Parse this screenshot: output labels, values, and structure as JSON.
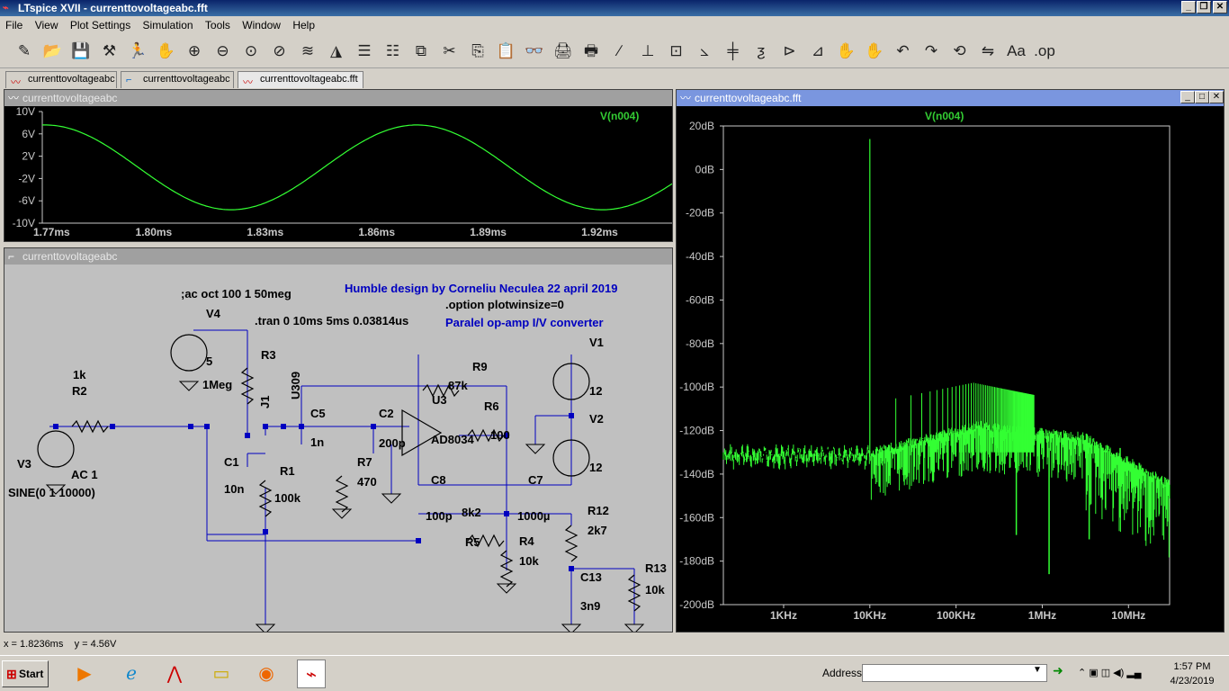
{
  "window": {
    "title": "LTspice XVII - currenttovoltageabc.fft"
  },
  "menu": [
    "File",
    "View",
    "Plot Settings",
    "Simulation",
    "Tools",
    "Window",
    "Help"
  ],
  "toolbar_icons": [
    "new-schematic-icon",
    "open-icon",
    "save-icon",
    "control-panel-icon",
    "run-icon",
    "halt-icon",
    "zoom-in-icon",
    "zoom-out-icon",
    "zoom-full-icon",
    "zoom-cancel-icon",
    "autorange-icon",
    "pick-visible-icon",
    "tile-icon",
    "cascade-icon",
    "close-icon",
    "cut-icon",
    "copy-icon",
    "paste-icon",
    "find-icon",
    "print-setup-icon",
    "print-icon",
    "draw-wire-icon",
    "ground-icon",
    "label-net-icon",
    "resistor-icon",
    "capacitor-icon",
    "inductor-icon",
    "diode-icon",
    "component-icon",
    "move-icon",
    "drag-icon",
    "undo-icon",
    "redo-icon",
    "rotate-icon",
    "mirror-icon",
    "text-icon",
    "spice-directive-icon"
  ],
  "tabs": [
    "currenttovoltageabc",
    "currenttovoltageabc",
    "currenttovoltageabc.fft"
  ],
  "transient_pane": {
    "title": "currenttovoltageabc",
    "trace": "V(n004)",
    "y_ticks": [
      "10V",
      "6V",
      "2V",
      "-2V",
      "-6V",
      "-10V"
    ],
    "x_ticks": [
      "1.77ms",
      "1.80ms",
      "1.83ms",
      "1.86ms",
      "1.89ms",
      "1.92ms"
    ]
  },
  "schematic_pane": {
    "title": "currenttovoltageabc",
    "texts": {
      "ac": ";ac oct 100 1 50meg",
      "designer": "Humble design by Corneliu Neculea 22 april 2019",
      "option": ".option plotwinsize=0",
      "tran": ".tran 0 10ms 5ms 0.03814us",
      "desc": "Paralel op-amp I/V converter",
      "V4": "V4",
      "V4val": "5",
      "R3": "R3",
      "R3val": "1Meg",
      "J1": "J1",
      "U309": "U309",
      "C5": "C5",
      "C5val": "1n",
      "C2": "C2",
      "C2val": "200p",
      "R7": "R7",
      "R7val": "470",
      "U3": "U3",
      "AD8034": "AD8034",
      "R6": "R6",
      "R6val": "100",
      "R9": "R9",
      "R9val": "87k",
      "V1": "V1",
      "V1val": "12",
      "V2": "V2",
      "V2val": "12",
      "R2": "R2",
      "R2val": "1k",
      "V3": "V3",
      "AC1": "AC 1",
      "SINE": "SINE(0 1 10000)",
      "C1": "C1",
      "C1val": "10n",
      "R1": "R1",
      "R1val": "100k",
      "C8": "C8",
      "C8val": "100p",
      "R5": "R5",
      "R5val": "8k2",
      "C7": "C7",
      "C7val": "1000µ",
      "R4": "R4",
      "R4val": "10k",
      "R12": "R12",
      "R12val": "2k7",
      "C13": "C13",
      "C13val": "3n9",
      "R13": "R13",
      "R13val": "10k"
    }
  },
  "fft_pane": {
    "title": "currenttovoltageabc.fft",
    "trace": "V(n004)",
    "y_ticks": [
      "20dB",
      "0dB",
      "-20dB",
      "-40dB",
      "-60dB",
      "-80dB",
      "-100dB",
      "-120dB",
      "-140dB",
      "-160dB",
      "-180dB",
      "-200dB"
    ],
    "x_ticks": [
      "1KHz",
      "10KHz",
      "100KHz",
      "1MHz",
      "10MHz"
    ]
  },
  "status": {
    "text": "x = 1.8236ms    y = 4.56V"
  },
  "taskbar": {
    "start": "Start",
    "address_label": "Address",
    "time": "1:57 PM",
    "date": "4/23/2019"
  },
  "colors": {
    "trace": "#33ff33",
    "titlebar": "#0a246a",
    "schem_bg": "#c0c0c0",
    "wire": "#0000c0"
  }
}
